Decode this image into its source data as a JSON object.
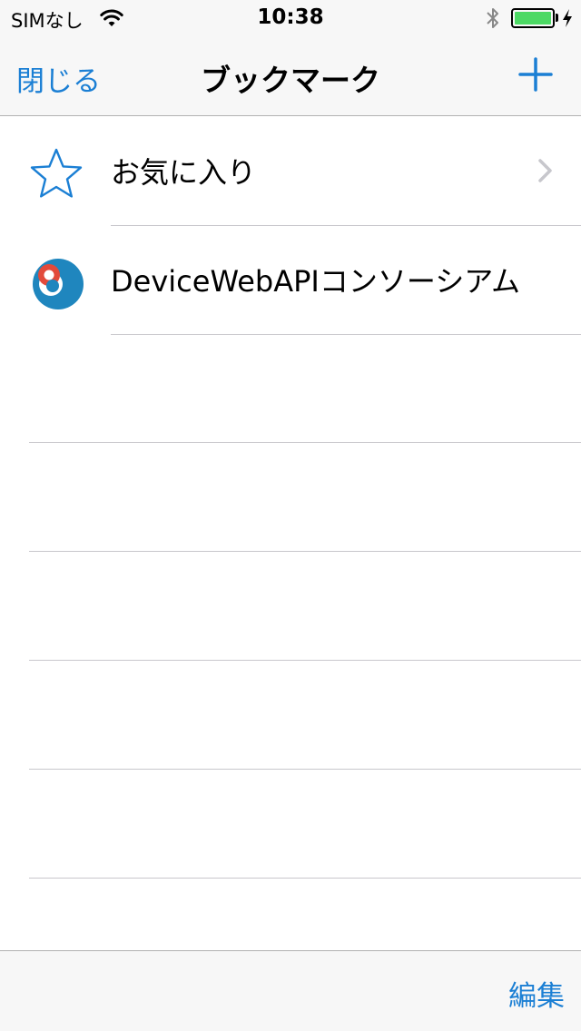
{
  "status_bar": {
    "carrier": "SIMなし",
    "time": "10:38",
    "battery_level": 1.0,
    "icons": [
      "wifi-icon",
      "bluetooth-icon",
      "battery-icon",
      "charging-bolt-icon"
    ]
  },
  "nav": {
    "close_label": "閉じる",
    "title": "ブックマーク",
    "add_icon": "plus-icon"
  },
  "bookmarks": [
    {
      "label": "お気に入り",
      "icon": "star-icon",
      "has_chevron": true
    },
    {
      "label": "DeviceWebAPIコンソーシアム",
      "icon": "site-favicon-icon",
      "has_chevron": false
    }
  ],
  "toolbar": {
    "edit_label": "編集"
  },
  "colors": {
    "accent": "#1b7fd4",
    "bar_background": "#f7f7f7",
    "separator": "#c8c7cc",
    "battery_fill": "#4cd964"
  }
}
